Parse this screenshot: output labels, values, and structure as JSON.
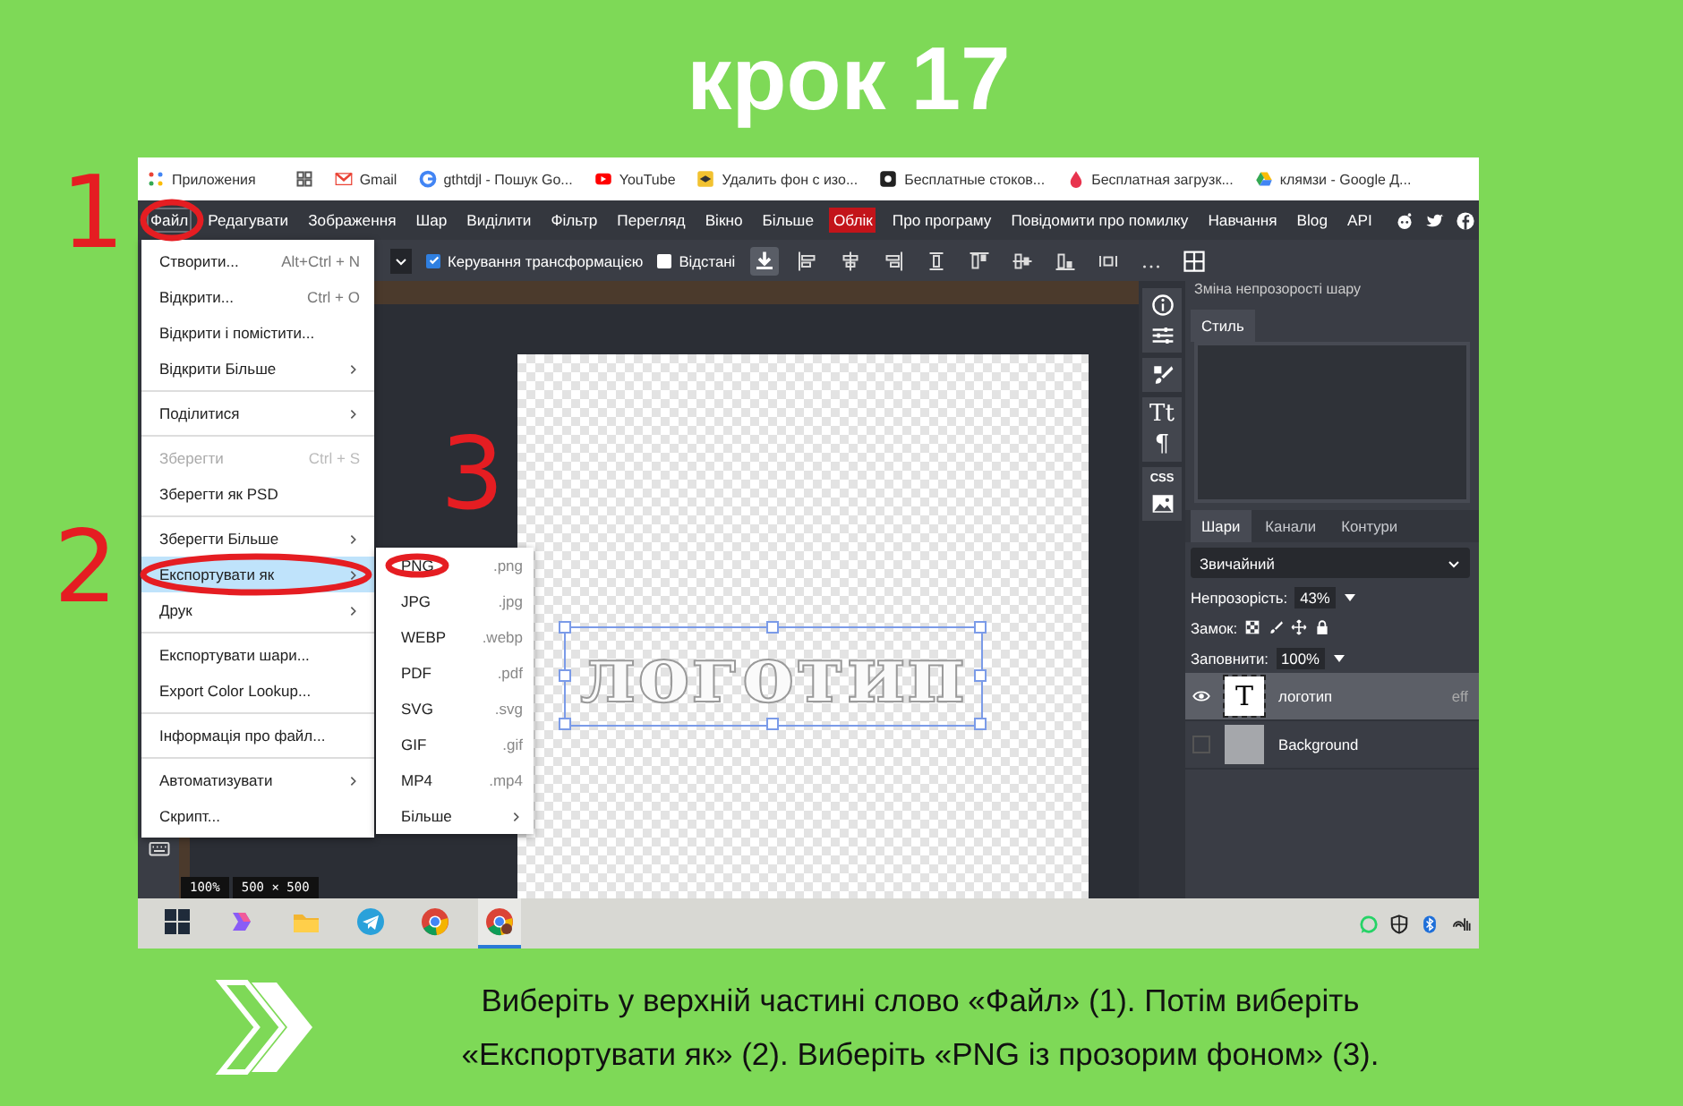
{
  "title": "крок 17",
  "bookmarks": [
    {
      "label": "Приложения"
    },
    {
      "label": "Gmail"
    },
    {
      "label": "gthtdjl - Пошук Go..."
    },
    {
      "label": "YouTube"
    },
    {
      "label": "Удалить фон с изо..."
    },
    {
      "label": "Бесплатные стоков..."
    },
    {
      "label": "Бесплатная загрузк..."
    },
    {
      "label": "клямзи - Google Д..."
    }
  ],
  "menubar": [
    {
      "label": "Файл",
      "kind": "menu",
      "selected": true
    },
    {
      "label": "Редагувати",
      "kind": "menu",
      "selected": false
    },
    {
      "label": "Зображення",
      "kind": "menu",
      "selected": false
    },
    {
      "label": "Шар",
      "kind": "menu",
      "selected": false
    },
    {
      "label": "Виділити",
      "kind": "menu",
      "selected": false
    },
    {
      "label": "Фільтр",
      "kind": "menu",
      "selected": false
    },
    {
      "label": "Перегляд",
      "kind": "menu",
      "selected": false
    },
    {
      "label": "Вікно",
      "kind": "menu",
      "selected": false
    },
    {
      "label": "Більше",
      "kind": "menu",
      "selected": false
    },
    {
      "label": "Облік",
      "kind": "account",
      "selected": false
    },
    {
      "label": "Про програму",
      "kind": "menu",
      "selected": false
    },
    {
      "label": "Повідомити про помилку",
      "kind": "menu",
      "selected": false
    },
    {
      "label": "Навчання",
      "kind": "menu",
      "selected": false
    },
    {
      "label": "Blog",
      "kind": "menu",
      "selected": false
    },
    {
      "label": "API",
      "kind": "menu",
      "selected": false
    }
  ],
  "toolbar": {
    "checkboxes": [
      {
        "label": "Керування трансформацією",
        "checked": true
      },
      {
        "label": "Відстані",
        "checked": false
      }
    ]
  },
  "file_menu": {
    "groups": [
      [
        {
          "label": "Створити...",
          "shortcut": "Alt+Ctrl + N",
          "submenu": false,
          "disabled": false,
          "selected": false
        },
        {
          "label": "Відкрити...",
          "shortcut": "Ctrl + O",
          "submenu": false,
          "disabled": false,
          "selected": false
        },
        {
          "label": "Відкрити і помістити...",
          "submenu": false,
          "disabled": false,
          "selected": false
        },
        {
          "label": "Відкрити Більше",
          "submenu": true,
          "disabled": false,
          "selected": false
        }
      ],
      [
        {
          "label": "Поділитися",
          "submenu": true,
          "disabled": false,
          "selected": false
        }
      ],
      [
        {
          "label": "Зберегти",
          "shortcut": "Ctrl + S",
          "submenu": false,
          "disabled": true,
          "selected": false
        },
        {
          "label": "Зберегти як PSD",
          "submenu": false,
          "disabled": false,
          "selected": false
        }
      ],
      [
        {
          "label": "Зберегти Більше",
          "submenu": true,
          "disabled": false,
          "selected": false
        },
        {
          "label": "Експортувати як",
          "submenu": true,
          "disabled": false,
          "selected": true
        },
        {
          "label": "Друк",
          "submenu": true,
          "disabled": false,
          "selected": false
        }
      ],
      [
        {
          "label": "Експортувати шари...",
          "submenu": false,
          "disabled": false,
          "selected": false
        },
        {
          "label": "Export Color Lookup...",
          "submenu": false,
          "disabled": false,
          "selected": false
        }
      ],
      [
        {
          "label": "Інформація про файл...",
          "submenu": false,
          "disabled": false,
          "selected": false
        }
      ],
      [
        {
          "label": "Автоматизувати",
          "submenu": true,
          "disabled": false,
          "selected": false
        },
        {
          "label": "Скрипт...",
          "submenu": false,
          "disabled": false,
          "selected": false
        }
      ]
    ]
  },
  "export_submenu": [
    {
      "label": "PNG",
      "ext": ".png",
      "submenu": false
    },
    {
      "label": "JPG",
      "ext": ".jpg",
      "submenu": false
    },
    {
      "label": "WEBP",
      "ext": ".webp",
      "submenu": false
    },
    {
      "label": "PDF",
      "ext": ".pdf",
      "submenu": false
    },
    {
      "label": "SVG",
      "ext": ".svg",
      "submenu": false
    },
    {
      "label": "GIF",
      "ext": ".gif",
      "submenu": false
    },
    {
      "label": "MP4",
      "ext": ".mp4",
      "submenu": false
    },
    {
      "label": "Більше",
      "submenu": true
    }
  ],
  "canvas": {
    "text": "логотип",
    "zoom": "100%",
    "size": "500 × 500"
  },
  "right_tools": {
    "text_tool": "Tt",
    "paragraph": "¶",
    "css": "CSS"
  },
  "panel": {
    "header": "Зміна непрозорості шару",
    "style_tabs": [
      {
        "label": "Стиль",
        "selected": true
      }
    ],
    "layer_tabs": [
      {
        "label": "Шари",
        "selected": true
      },
      {
        "label": "Канали",
        "selected": false
      },
      {
        "label": "Контури",
        "selected": false
      }
    ],
    "blend": "Звичайний",
    "opacity_label": "Непрозорість:",
    "opacity": "43%",
    "lock_label": "Замок:",
    "fill_label": "Заповнити:",
    "fill": "100%",
    "layers": [
      {
        "name": "логотип",
        "kind": "text",
        "thumb": "T",
        "badge": "eff",
        "visible": true,
        "selected": true
      },
      {
        "name": "Background",
        "kind": "fill",
        "visible": false,
        "selected": false
      }
    ]
  },
  "taskbar": {
    "apps": [
      {
        "selected": false
      },
      {
        "selected": false
      },
      {
        "selected": false
      },
      {
        "selected": false
      },
      {
        "selected": false
      },
      {
        "selected": true
      }
    ]
  },
  "annotations": [
    "1",
    "2",
    "3"
  ],
  "caption": [
    "Виберіть у верхній частині слово «Файл» (1). Потім виберіть",
    "«Експортувати як» (2). Виберіть «PNG із прозорим фоном» (3)."
  ]
}
